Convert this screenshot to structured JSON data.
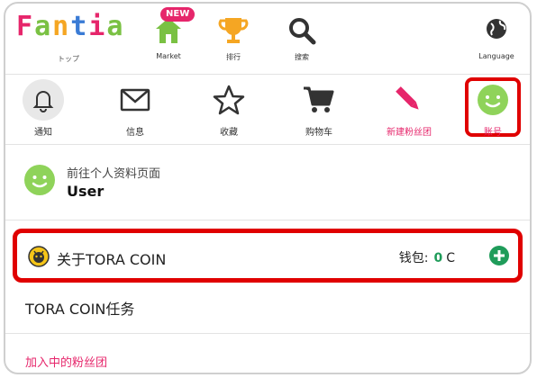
{
  "header": {
    "logo": "Fantia",
    "logo_caption": "トップ",
    "new_badge": "NEW",
    "market_label": "Market",
    "ranking_label": "排行",
    "search_label": "搜索",
    "language_label": "Language"
  },
  "nav": {
    "notify": "通知",
    "messages": "信息",
    "favorites": "收藏",
    "cart": "购物车",
    "new_fanclub": "新建粉丝团",
    "account": "账号"
  },
  "profile": {
    "goto_label": "前往个人资料页面",
    "username": "User"
  },
  "tora": {
    "about_label": "关于TORA COIN",
    "wallet_label": "钱包:",
    "balance": "0",
    "unit": "C"
  },
  "menu": {
    "mission": "TORA COIN任务",
    "joined_fanclubs": "加入中的粉丝团"
  },
  "colors": {
    "logo_letters": [
      "#e6266b",
      "#7ac143",
      "#f5a623",
      "#3a7bd5",
      "#e6266b",
      "#7ac143"
    ],
    "accent_pink": "#e6266b",
    "green_avatar": "#8fd35a",
    "coin_green": "#1f9c5a",
    "highlight_red": "#e00000"
  },
  "icons": [
    "home-icon",
    "trophy-icon",
    "search-icon",
    "globe-icon",
    "bell-icon",
    "envelope-icon",
    "star-icon",
    "cart-icon",
    "pencil-icon",
    "smiley-avatar-icon",
    "coin-icon",
    "plus-icon"
  ]
}
